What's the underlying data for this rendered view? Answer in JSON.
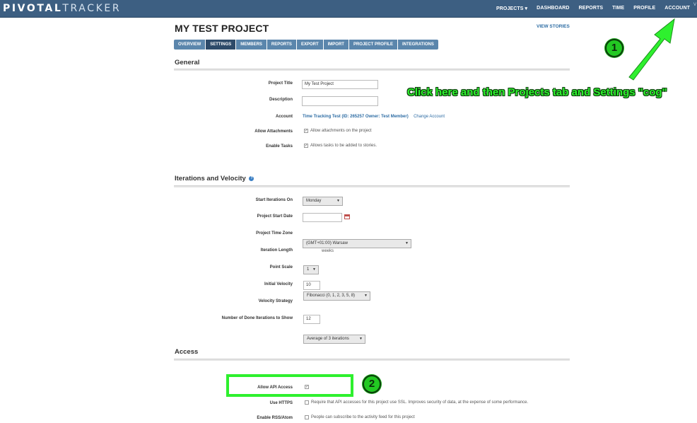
{
  "header": {
    "logo_part1": "PIVOTAL",
    "logo_part2": "TRACKER",
    "nav": [
      "PROJECTS ▾",
      "DASHBOARD",
      "REPORTS",
      "TIME",
      "PROFILE",
      "ACCOUNT"
    ],
    "corner_mark": "V"
  },
  "project": {
    "title": "MY TEST PROJECT",
    "view_stories": "VIEW STORIES",
    "tabs": [
      "OVERVIEW",
      "SETTINGS",
      "MEMBERS",
      "REPORTS",
      "EXPORT",
      "IMPORT",
      "PROJECT PROFILE",
      "INTEGRATIONS"
    ],
    "active_tab": "SETTINGS"
  },
  "general": {
    "title": "General",
    "project_title_label": "Project Title",
    "project_title_value": "My Test Project",
    "description_label": "Description",
    "account_label": "Account",
    "account_value": "Time Tracking Test (ID: 265257 Owner: Test Member)",
    "change_account": "Change Account",
    "allow_attachments_label": "Allow Attachments",
    "allow_attachments_text": "Allow attachments on the project",
    "allow_attachments_checked": true,
    "enable_tasks_label": "Enable Tasks",
    "enable_tasks_text": "Allows tasks to be added to stories.",
    "enable_tasks_checked": true
  },
  "iterations": {
    "title": "Iterations and Velocity",
    "help_icon": "question-icon",
    "start_on_label": "Start Iterations On",
    "start_on_value": "Monday",
    "start_date_label": "Project Start Date",
    "start_date_value": "",
    "calendar_icon": "calendar-icon",
    "timezone_label": "Project Time Zone",
    "timezone_value": "(GMT+01:00) Warsaw",
    "iter_length_label": "Iteration Length",
    "iter_length_value": "1",
    "iter_length_unit": "weeks",
    "point_scale_label": "Point Scale",
    "point_scale_value": "Fibonacci (0, 1, 2, 3, 5, 8)",
    "initial_velocity_label": "Initial Velocity",
    "initial_velocity_value": "10",
    "velocity_strategy_label": "Velocity Strategy",
    "velocity_strategy_value": "Average of 3 iterations",
    "done_iterations_label": "Number of Done Iterations to Show",
    "done_iterations_value": "12"
  },
  "access": {
    "title": "Access",
    "allow_api_label": "Allow API Access",
    "allow_api_checked": true,
    "use_https_label": "Use HTTPS",
    "use_https_text": "Require that API accesses for this project use SSL. Improves security of data, at the expense of some performance.",
    "use_https_checked": false,
    "enable_rss_label": "Enable RSS/Atom",
    "enable_rss_text": "People can subscribe to the activity feed for this project",
    "enable_rss_checked": false
  },
  "annotations": {
    "instruction": "Click here and then Projects tab and Settings \"cog\"",
    "step1": "1",
    "step2": "2",
    "color": "#2ef02e"
  }
}
